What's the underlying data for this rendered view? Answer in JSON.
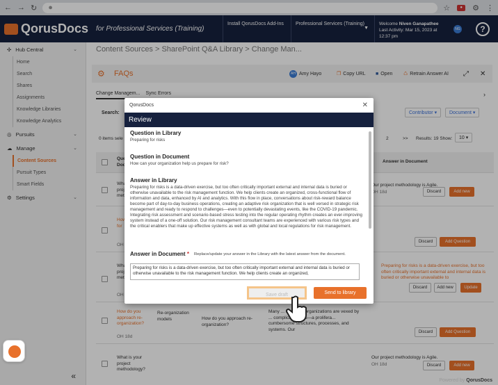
{
  "browser": {
    "icons": [
      "back-arrow-icon",
      "forward-arrow-icon",
      "reload-icon"
    ]
  },
  "header": {
    "brand": "QorusDocs",
    "tagline": "for Professional Services (Training)",
    "menu1": "Install QorusDocs Add-Ins",
    "menu2": "Professional Services (Training)",
    "welcome_prefix": "Welcome",
    "user": "Niven Ganapathee",
    "last_activity": "Last Activity: Mar 15, 2023 at 12:37 pm",
    "avatar": "NG",
    "help": "?"
  },
  "sidebar": {
    "hub": "Hub Central",
    "hub_items": [
      "Home",
      "Search",
      "Shares",
      "Assignments",
      "Knowledge Libraries",
      "Knowledge Analytics"
    ],
    "pursuits": "Pursuits",
    "manage": "Manage",
    "manage_items": [
      "Content Sources",
      "Pursuit Types",
      "Smart Fields"
    ],
    "settings": "Settings",
    "collapse": "«"
  },
  "main": {
    "breadcrumb": "Content Sources > SharePoint Q&A Library > Change Man...",
    "faq_title": "FAQs",
    "owner": "Amy Hayo",
    "owner_initials": "AH",
    "copy_url": "Copy URL",
    "open": "Open",
    "retrain": "Retrain Answer AI",
    "tab1": "Change Managem...",
    "tab2": "Sync Errors",
    "search_label": "Search:",
    "contributor": "Contributor",
    "document": "Document",
    "items": "0 items sele",
    "page": "2",
    "next": ">>",
    "results": "Results: 19 Show:",
    "show": "10",
    "col_que": "Que",
    "col_doc": "Doc",
    "col_answer_doc": "Answer in Document"
  },
  "rows": [
    {
      "q1": "What",
      "q2": "project",
      "q3": "methodo",
      "ans": "Our project methodology is Agile.",
      "oh": "OH 18d",
      "b1": "Discard",
      "b2": "Add new"
    },
    {
      "q1": "How de",
      "q2": "for",
      "oh": "OH 1",
      "b1": "Discard",
      "b2": "Add Question"
    },
    {
      "q1": "What i",
      "q2": "project",
      "q3": "method",
      "ans": "Preparing for risks is a data-driven exercise, but too often critically important external and internal data is buried or otherwise unavailable to",
      "oh": "OH 18d",
      "b1": "Discard",
      "b2": "Add new",
      "b3": "Update"
    },
    {
      "q": "How do you approach re-organization?",
      "doc": "Re-organization models",
      "doc2": "How do you approach re-organization?",
      "ans": "Many ... business organizations are vexed by ... complicatedness—a prolifera... cumbersome structures, processes, and systems. Our",
      "oh": "OH 18d",
      "b1": "Discard",
      "b2": "Add Question"
    },
    {
      "q": "What is your project methodology?",
      "ans": "Our project methodology is Agile.",
      "oh": "OH 18d",
      "b1": "Discard",
      "b2": "Add new"
    }
  ],
  "modal": {
    "app": "QorusDocs",
    "title": "Review",
    "q_lib_h": "Question in Library",
    "q_lib": "Preparing for risks",
    "q_doc_h": "Question in Document",
    "q_doc": "How can your organization help us prepare for risk?",
    "a_lib_h": "Answer in Library",
    "a_lib": "Preparing for risks is a data-driven exercise, but too often critically important external and internal data is buried or otherwise unavailable to the risk management function. We help clients create an organized, cross-functional flow of information and data, enhanced by AI and analytics. With this flow in place, conversations about risk-reward balance become part of day-to-day business operations, creating an adaptive risk organization that is well versed in strategic risk management and ready to respond to challenges—even to potentially devastating events, like the COVID-19 pandemic. Integrating risk assessment and scenario-based stress testing into the regular operating rhythm creates an ever-improving system instead of a one-off solution. Our risk management consultant teams are experienced with various risk types and the critical enablers that make up effective systems as well as with global and local regulations for risk management.",
    "a_doc_h": "Answer in Document",
    "a_doc_hint": "Replace/update your answer in the Library with the latest answer from the document.",
    "a_doc": "Preparing for risks is a data-driven exercise, but too often critically important external and internal data is buried or otherwise unavailable to the risk management function. We help clients create an organized,",
    "save": "Save draft",
    "send": "Send to library"
  },
  "footer": {
    "powered": "Powered by",
    "brand": "QorusDocs"
  }
}
